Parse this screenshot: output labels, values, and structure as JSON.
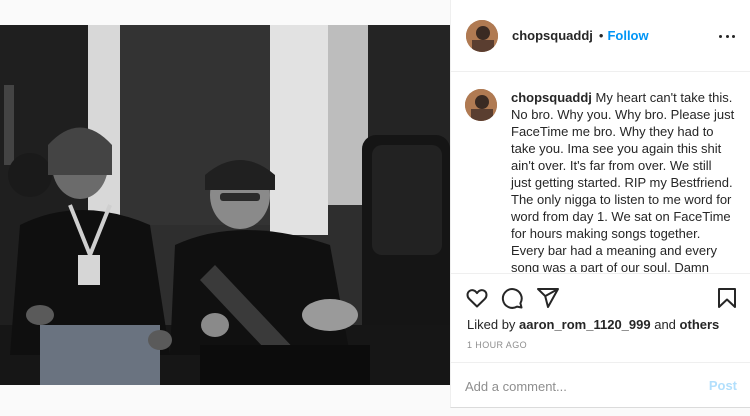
{
  "post": {
    "author": "chopsquaddj",
    "separator": "•",
    "follow_label": "Follow",
    "more_icon": "more-horizontal-icon",
    "caption_author": "chopsquaddj",
    "caption": "My heart can't take this. No bro. Why you. Why bro. Please just FaceTime me bro. Why they had to take you. Ima see you again this shit ain't over. It's far from over. We still just getting started. RIP my Bestfriend. The only nigga to listen to me word for word from day 1. We sat on FaceTime for hours making songs together. Every bar had a meaning and every song was a part of our soul. Damn man we was just getting started.",
    "liked_by_prefix": "Liked by",
    "liked_by_user": "aaron_rom_1120_999",
    "liked_by_suffix": "and",
    "liked_by_others": "others",
    "timestamp": "1 HOUR AGO",
    "comment_placeholder": "Add a comment...",
    "post_label": "Post"
  },
  "icons": {
    "like": "heart-icon",
    "comment": "comment-icon",
    "share": "share-icon",
    "save": "bookmark-icon"
  },
  "colors": {
    "accent": "#0095f6",
    "post_disabled": "#b2dffc",
    "muted": "#8e8e8e"
  }
}
